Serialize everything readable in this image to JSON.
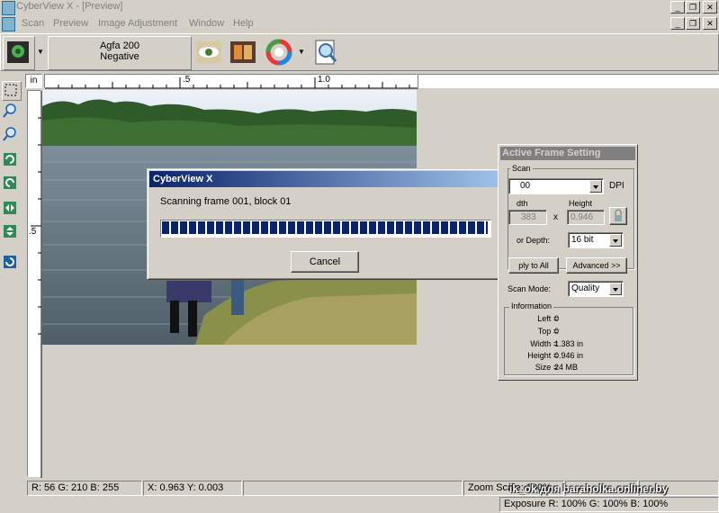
{
  "window": {
    "title": "CyberView X - [Preview]"
  },
  "menu": [
    "Scan",
    "Preview",
    "Image Adjustment",
    "Window",
    "Help"
  ],
  "film": {
    "line1": "Agfa 200",
    "line2": "Negative"
  },
  "ruler": {
    "unit": "in",
    "h_labels": [
      ".5",
      "1.0"
    ],
    "v_labels": [
      ".5"
    ]
  },
  "dialog": {
    "title": "CyberView X",
    "message": "Scanning frame 001, block 01",
    "progress": 1.0,
    "cancel_label": "Cancel"
  },
  "frame_setting": {
    "title": "Active Frame Setting",
    "scan_group": "Scan",
    "dpi_value": "00",
    "dpi_label": "DPI",
    "width_label": "dth",
    "height_label": "Height",
    "width_value": "383",
    "x_label": "x",
    "height_value": "0.946",
    "color_depth_label": "or Depth:",
    "color_depth_value": "16 bit",
    "apply_all_label": "ply to All",
    "advanced_label": "Advanced >>",
    "scan_mode_label": "Scan Mode:",
    "scan_mode_value": "Quality",
    "info_group": "Information",
    "info": [
      {
        "label": "Left =",
        "value": "0"
      },
      {
        "label": "Top =",
        "value": "0"
      },
      {
        "label": "Width =",
        "value": "1.383  in"
      },
      {
        "label": "Height =",
        "value": "0.946  in"
      },
      {
        "label": "Size =",
        "value": "24 MB"
      }
    ]
  },
  "status": {
    "rgb": "R: 56  G: 210 B: 255",
    "xy": "X: 0.963  Y: 0.003",
    "zoom": "Zoom Scale: 100%",
    "exposure": "Exposure R: 100%  G: 100%  B: 100%",
    "watermark": "ik_ok для baraholka.onliner.by"
  },
  "colors": {
    "accent": "#0a246a",
    "progress": "#0a246a",
    "face": "#d4d0c8"
  }
}
